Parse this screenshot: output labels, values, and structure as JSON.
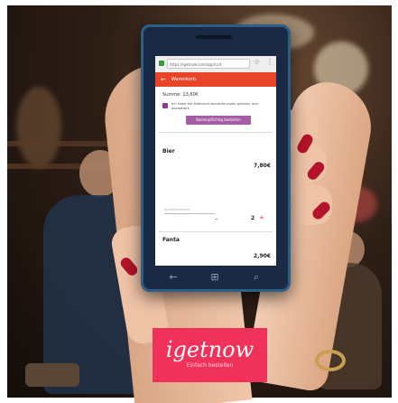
{
  "browser": {
    "url": "https://igetnow.com/app/cart"
  },
  "app": {
    "header_title": "Warenkorb",
    "sum_text": "Summe: 13,60€",
    "consent_text": "Ich habe die Datenschutzerklärungen gelesen und akzeptiert.",
    "order_button": "Kostenpflichtig bestellen"
  },
  "cart": {
    "items": [
      {
        "name": "Bier",
        "price": "7,80€",
        "note_placeholder": "Sonderwünsche",
        "quantity": "2"
      },
      {
        "name": "Fanta",
        "price": "2,90€"
      }
    ]
  },
  "brand": {
    "logo_text": "igetnow",
    "tagline": "Einfach bestellen"
  },
  "colors": {
    "header_red": "#e8442a",
    "button_purple": "#a55ea5",
    "brand_pink": "#f0325a"
  }
}
